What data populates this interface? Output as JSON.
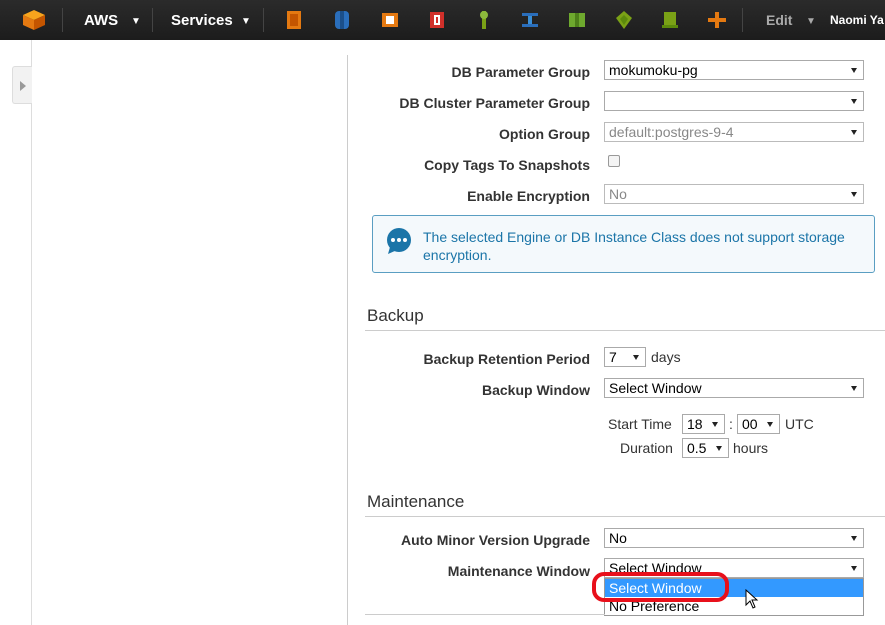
{
  "nav": {
    "aws_label": "AWS",
    "services_label": "Services",
    "edit_label": "Edit",
    "user_label": "Naomi Ya",
    "service_icons": [
      "ec2-icon",
      "s3-icon",
      "cloudfront-icon",
      "rds-icon",
      "iam-icon",
      "elb-icon",
      "cloudformation-icon",
      "elastic-beanstalk-icon",
      "opsworks-icon",
      "cloudtrail-icon"
    ]
  },
  "form": {
    "db_parameter_group": {
      "label": "DB Parameter Group",
      "value": "mokumoku-pg"
    },
    "db_cluster_parameter_group": {
      "label": "DB Cluster Parameter Group",
      "value": ""
    },
    "option_group": {
      "label": "Option Group",
      "value": "default:postgres-9-4"
    },
    "copy_tags": {
      "label": "Copy Tags To Snapshots"
    },
    "enable_encryption": {
      "label": "Enable Encryption",
      "value": "No"
    }
  },
  "info": {
    "message": "The selected Engine or DB Instance Class does not support storage encryption."
  },
  "backup": {
    "title": "Backup",
    "retention_label": "Backup Retention Period",
    "retention_value": "7",
    "retention_unit": "days",
    "window_label": "Backup Window",
    "window_value": "Select Window",
    "start_time_label": "Start Time",
    "start_hour": "18",
    "colon": ":",
    "start_minute": "00",
    "utc": "UTC",
    "duration_label": "Duration",
    "duration_value": "0.5",
    "duration_unit": "hours"
  },
  "maintenance": {
    "title": "Maintenance",
    "auto_minor_label": "Auto Minor Version Upgrade",
    "auto_minor_value": "No",
    "window_label": "Maintenance Window",
    "window_value": "Select Window",
    "options": [
      "Select Window",
      "No Preference"
    ]
  },
  "colors": {
    "nav_bg": "#1c1c1c",
    "info_text": "#1b75a8",
    "selected_option": "#3399ff",
    "highlight_ring": "#e8101b"
  }
}
